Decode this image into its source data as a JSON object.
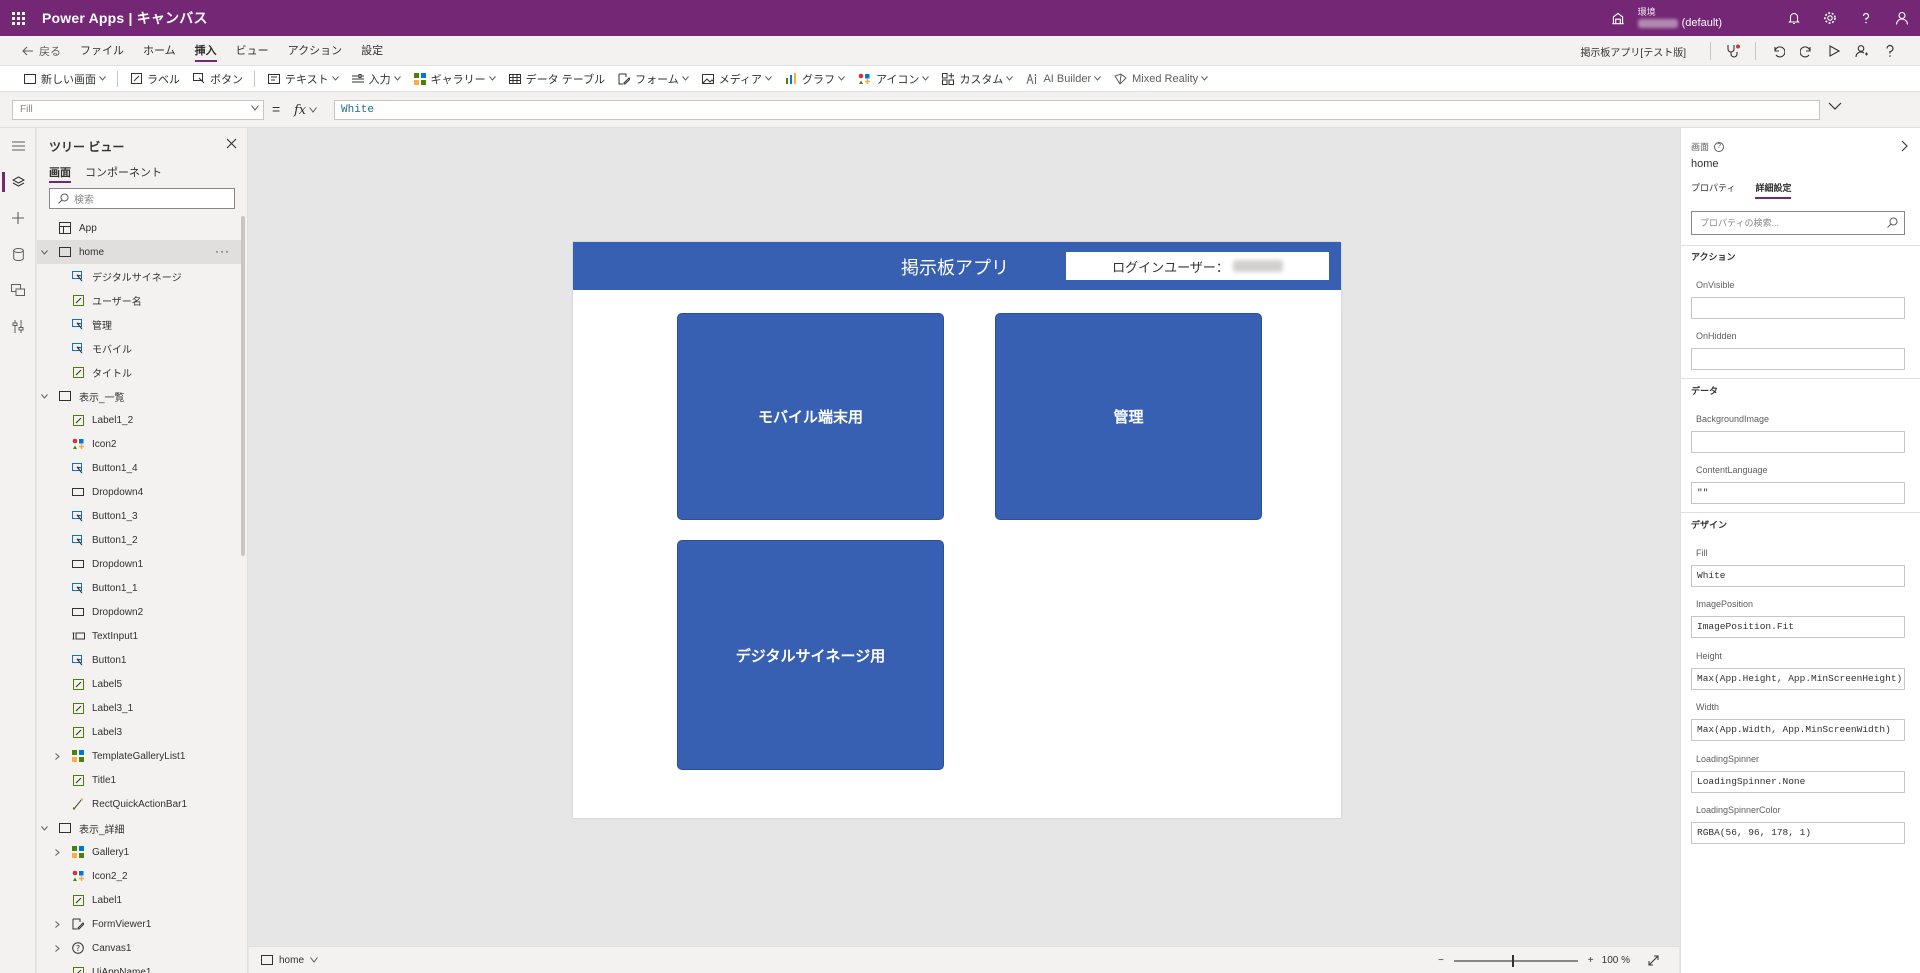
{
  "appbar": {
    "brand": "Power Apps | キャンバス",
    "env_label": "環境",
    "env_value": "(default)"
  },
  "menu": {
    "back": "戻る",
    "items": [
      "ファイル",
      "ホーム",
      "挿入",
      "ビュー",
      "アクション",
      "設定"
    ],
    "active_index": 2,
    "app_name": "掲示板アプリ[テスト版]"
  },
  "ribbon": {
    "new_screen": "新しい画面",
    "label": "ラベル",
    "button": "ボタン",
    "text": "テキスト",
    "input": "入力",
    "gallery": "ギャラリー",
    "data_table": "データ テーブル",
    "form": "フォーム",
    "media": "メディア",
    "chart": "グラフ",
    "icon": "アイコン",
    "custom": "カスタム",
    "ai_builder": "AI Builder",
    "mixed_reality": "Mixed Reality"
  },
  "formula": {
    "property": "Fill",
    "equals": "=",
    "fx": "fx",
    "value": "White"
  },
  "tree": {
    "title": "ツリー ビュー",
    "tabs": [
      "画面",
      "コンポーネント"
    ],
    "search_placeholder": "検索",
    "nodes": [
      {
        "label": "App",
        "level": 0,
        "icon": "app",
        "expander": ""
      },
      {
        "label": "home",
        "level": 0,
        "icon": "screen",
        "expander": "open",
        "selected": true
      },
      {
        "label": "デジタルサイネージ",
        "level": 1,
        "icon": "button"
      },
      {
        "label": "ユーザー名",
        "level": 1,
        "icon": "label"
      },
      {
        "label": "管理",
        "level": 1,
        "icon": "button"
      },
      {
        "label": "モバイル",
        "level": 1,
        "icon": "button"
      },
      {
        "label": "タイトル",
        "level": 1,
        "icon": "label"
      },
      {
        "label": "表示_一覧",
        "level": 0,
        "icon": "screen",
        "expander": "open"
      },
      {
        "label": "Label1_2",
        "level": 1,
        "icon": "label"
      },
      {
        "label": "Icon2",
        "level": 1,
        "icon": "iconctl"
      },
      {
        "label": "Button1_4",
        "level": 1,
        "icon": "button"
      },
      {
        "label": "Dropdown4",
        "level": 1,
        "icon": "dropdown"
      },
      {
        "label": "Button1_3",
        "level": 1,
        "icon": "button"
      },
      {
        "label": "Button1_2",
        "level": 1,
        "icon": "button"
      },
      {
        "label": "Dropdown1",
        "level": 1,
        "icon": "dropdown"
      },
      {
        "label": "Button1_1",
        "level": 1,
        "icon": "button"
      },
      {
        "label": "Dropdown2",
        "level": 1,
        "icon": "dropdown"
      },
      {
        "label": "TextInput1",
        "level": 1,
        "icon": "textinput"
      },
      {
        "label": "Button1",
        "level": 1,
        "icon": "button"
      },
      {
        "label": "Label5",
        "level": 1,
        "icon": "label"
      },
      {
        "label": "Label3_1",
        "level": 1,
        "icon": "label"
      },
      {
        "label": "Label3",
        "level": 1,
        "icon": "label"
      },
      {
        "label": "TemplateGalleryList1",
        "level": 1,
        "icon": "gallery",
        "expander": "closed"
      },
      {
        "label": "Title1",
        "level": 1,
        "icon": "label"
      },
      {
        "label": "RectQuickActionBar1",
        "level": 1,
        "icon": "rect"
      },
      {
        "label": "表示_詳細",
        "level": 0,
        "icon": "screen",
        "expander": "open"
      },
      {
        "label": "Gallery1",
        "level": 1,
        "icon": "gallery",
        "expander": "closed"
      },
      {
        "label": "Icon2_2",
        "level": 1,
        "icon": "iconctl"
      },
      {
        "label": "Label1",
        "level": 1,
        "icon": "label"
      },
      {
        "label": "FormViewer1",
        "level": 1,
        "icon": "form",
        "expander": "closed"
      },
      {
        "label": "Canvas1",
        "level": 1,
        "icon": "canvas",
        "expander": "closed"
      },
      {
        "label": "UiAppName1",
        "level": 1,
        "icon": "label"
      }
    ]
  },
  "screen": {
    "header_title": "掲示板アプリ",
    "login_label": "ログインユーザー：",
    "tile_mobile": "モバイル端末用",
    "tile_admin": "管理",
    "tile_signage": "デジタルサイネージ用",
    "primary_color": "#3860b2"
  },
  "status": {
    "screen_name": "home",
    "zoom_minus": "−",
    "zoom_plus": "+",
    "zoom": "100 %",
    "zoom_fraction": 0.47
  },
  "props": {
    "kind": "画面",
    "name": "home",
    "tabs": [
      "プロパティ",
      "詳細設定"
    ],
    "search_placeholder": "プロパティの検索...",
    "sections": {
      "action": "アクション",
      "data": "データ",
      "design": "デザイン"
    },
    "fields": {
      "onvisible": {
        "label": "OnVisible",
        "value": ""
      },
      "onhidden": {
        "label": "OnHidden",
        "value": ""
      },
      "backgroundimage": {
        "label": "BackgroundImage",
        "value": ""
      },
      "contentlanguage": {
        "label": "ContentLanguage",
        "value": "\"\""
      },
      "fill": {
        "label": "Fill",
        "value": "White"
      },
      "imageposition": {
        "label": "ImagePosition",
        "value": "ImagePosition.Fit"
      },
      "height": {
        "label": "Height",
        "value": "Max(App.Height, App.MinScreenHeight)"
      },
      "width": {
        "label": "Width",
        "value": "Max(App.Width, App.MinScreenWidth)"
      },
      "loadingspinner": {
        "label": "LoadingSpinner",
        "value": "LoadingSpinner.None"
      },
      "loadingspinnercolor": {
        "label": "LoadingSpinnerColor",
        "value": "RGBA(56, 96, 178, 1)"
      }
    }
  }
}
